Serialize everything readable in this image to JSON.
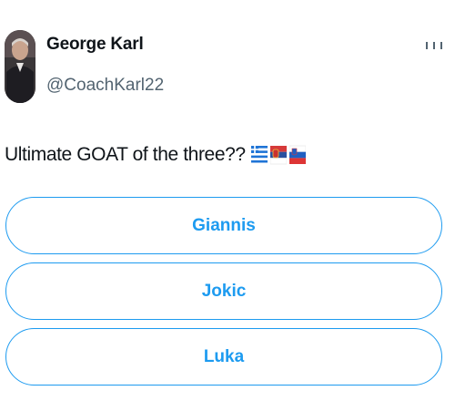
{
  "author": {
    "name": "George Karl",
    "handle": "@CoachKarl22",
    "avatar_icon": "person-avatar-photo"
  },
  "post": {
    "text": "Ultimate GOAT of the three??",
    "flags": [
      "greece-flag",
      "serbia-flag",
      "slovenia-flag"
    ]
  },
  "poll": {
    "options": [
      {
        "label": "Giannis"
      },
      {
        "label": "Jokic"
      },
      {
        "label": "Luka"
      }
    ]
  },
  "icons": {
    "more": "more-options-icon"
  },
  "colors": {
    "accent": "#1d9bf0",
    "text": "#0f1419",
    "secondary_text": "#536471",
    "background": "#ffffff"
  }
}
